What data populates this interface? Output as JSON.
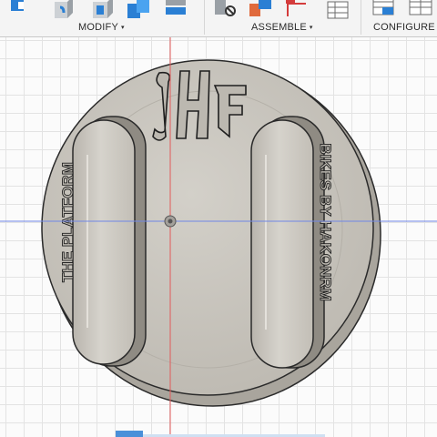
{
  "toolbar": {
    "groups": [
      {
        "label": "MODIFY",
        "caret": "▾"
      },
      {
        "label": "ASSEMBLE",
        "caret": "▾"
      },
      {
        "label": "CONFIGURE",
        "caret": "▾"
      }
    ]
  },
  "model": {
    "logo_text": "HF",
    "left_embossed_text": "THE PLATFORM",
    "right_embossed_text": "BIKES BY HAKONRM",
    "body_color": "#c9c6bf",
    "edge_color": "#2a2a2a"
  },
  "viewport": {
    "axis_red": "#e25a5a",
    "axis_blue": "#6f86e6",
    "grid_color": "#e3e3e3"
  },
  "colors": {
    "icon_blue": "#2a7fd4",
    "icon_grey": "#9aa0a6",
    "accent": "#4a90d9"
  }
}
